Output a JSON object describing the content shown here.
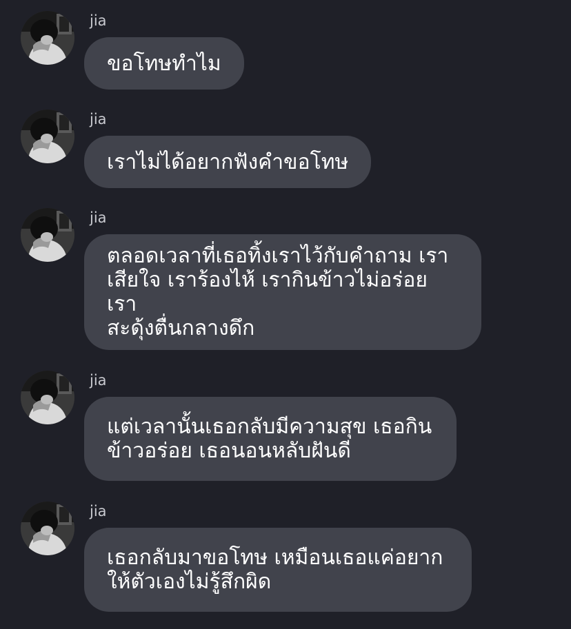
{
  "colors": {
    "background": "#1f2028",
    "bubble": "#41434c",
    "sender_text": "#c9cad0",
    "message_text": "#ffffff"
  },
  "messages": [
    {
      "sender": "jia",
      "avatar": "profile-photo-icon",
      "text": "ขอโทษทำไม"
    },
    {
      "sender": "jia",
      "avatar": "profile-photo-icon",
      "text": "เราไม่ได้อยากฟังคำขอโทษ"
    },
    {
      "sender": "jia",
      "avatar": "profile-photo-icon",
      "text": "ตลอดเวลาที่เธอทิ้งเราไว้กับคำถาม เรา\nเสียใจ เราร้องไห้ เรากินข้าวไม่อร่อย เรา\nสะดุ้งตื่นกลางดึก"
    },
    {
      "sender": "jia",
      "avatar": "profile-photo-icon",
      "text": "แต่เวลานั้นเธอกลับมีความสุข เธอกิน\nข้าวอร่อย เธอนอนหลับฝันดี"
    },
    {
      "sender": "jia",
      "avatar": "profile-photo-icon",
      "text": "เธอกลับมาขอโทษ เหมือนเธอแค่อยาก\nให้ตัวเองไม่รู้สึกผิด"
    }
  ]
}
